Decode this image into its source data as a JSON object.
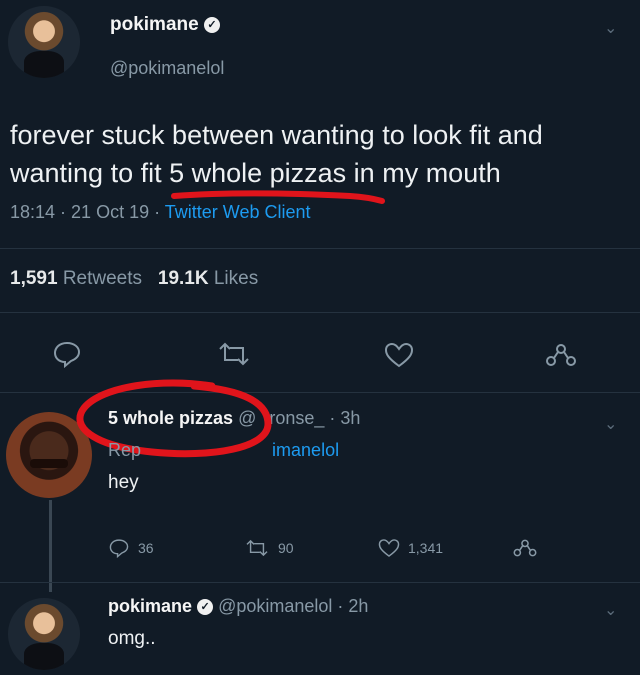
{
  "tweet": {
    "display_name": "pokimane",
    "handle": "@pokimanelol",
    "text_line1": "forever stuck between wanting to look fit and",
    "text_line2": "wanting to fit 5 whole pizzas in my mouth",
    "timestamp": "18:14 · 21 Oct 19 ·",
    "client": "Twitter Web Client",
    "retweets_count": "1,591",
    "retweets_label": "Retweets",
    "likes_count": "19.1K",
    "likes_label": "Likes"
  },
  "reply1": {
    "display_name": "5 whole pizzas",
    "handle_fragment": "@",
    "handle_rest": "ronse_",
    "time": "· 3h",
    "replying_prefix": "Rep",
    "replying_to": "imanelol",
    "text": "hey",
    "reply_count": "36",
    "retweet_count": "90",
    "like_count": "1,341"
  },
  "reply2": {
    "display_name": "pokimane",
    "handle": "@pokimanelol · 2h",
    "text": "omg.."
  },
  "icons": {
    "verified": "✓",
    "chevron": "⌄"
  },
  "colors": {
    "background": "#111b26",
    "link": "#1d9bf0",
    "annotation": "#e0141b"
  }
}
